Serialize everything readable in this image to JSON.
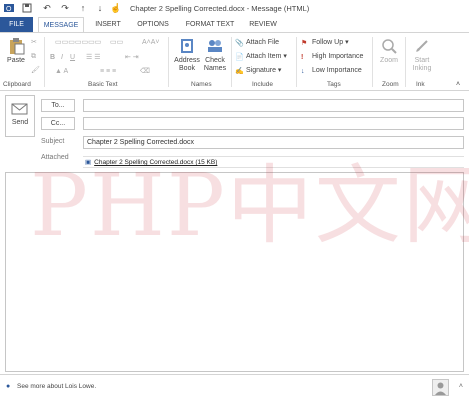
{
  "window": {
    "title": "Chapter 2 Spelling Corrected.docx - Message (HTML)"
  },
  "qat": {
    "save_icon": "save-icon",
    "undo_icon": "undo-icon",
    "redo_icon": "redo-icon",
    "up_icon": "up-arrow-icon",
    "down_icon": "down-arrow-icon",
    "touch_icon": "touch-mode-icon"
  },
  "tabs": {
    "file": "FILE",
    "message": "MESSAGE",
    "insert": "INSERT",
    "options": "OPTIONS",
    "format_text": "FORMAT TEXT",
    "review": "REVIEW"
  },
  "ribbon": {
    "clipboard": {
      "paste": "Paste",
      "label": "Clipboard"
    },
    "basic_text": {
      "label": "Basic Text"
    },
    "names": {
      "address_book": "Address Book",
      "check_names": "Check Names",
      "label": "Names"
    },
    "include": {
      "attach_file": "Attach File",
      "attach_item": "Attach Item",
      "signature": "Signature",
      "label": "Include"
    },
    "tags": {
      "follow_up": "Follow Up",
      "high_importance": "High Importance",
      "low_importance": "Low Importance",
      "label": "Tags"
    },
    "zoom": {
      "zoom": "Zoom",
      "label": "Zoom"
    },
    "ink": {
      "start_inking": "Start Inking",
      "label": "Ink"
    }
  },
  "compose": {
    "send": "Send",
    "to": "To...",
    "cc": "Cc...",
    "subject_label": "Subject",
    "subject_value": "Chapter 2 Spelling Corrected.docx",
    "attached_label": "Attached",
    "attachment": "Chapter 2 Spelling Corrected.docx (15 KB)"
  },
  "watermark": "PHP中文网 Office教程网",
  "status": {
    "text": "See more about Lois Lowe."
  },
  "colors": {
    "file_tab": "#2b579a",
    "accent": "#2b579a"
  }
}
